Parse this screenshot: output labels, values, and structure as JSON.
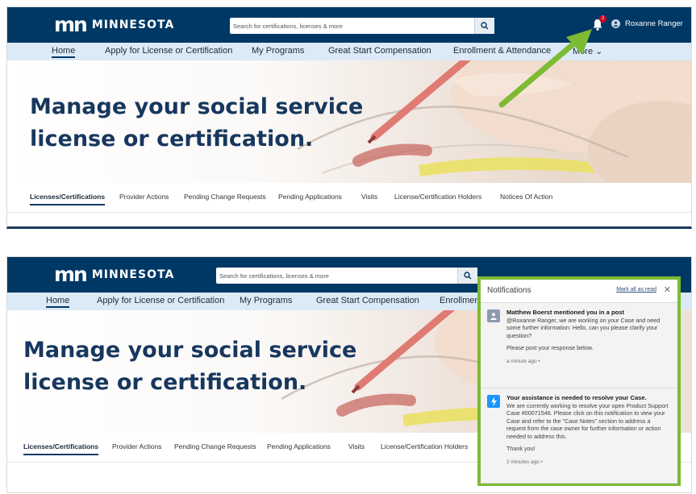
{
  "brand": {
    "mark": "mn",
    "name": "MINNESOTA"
  },
  "search": {
    "placeholder": "Search for certifications, licenses & more"
  },
  "user": {
    "name": "Roxanne Ranger"
  },
  "notifications_badge": "2",
  "nav": [
    "Home",
    "Apply for License or Certification",
    "My Programs",
    "Great Start Compensation",
    "Enrollment & Attendance",
    "More ⌄"
  ],
  "nav2_partial": "Enrollment &",
  "hero": {
    "line1": "Manage your social service",
    "line2": "license or certification."
  },
  "tabs": [
    "Licenses/Certifications",
    "Provider Actions",
    "Pending Change Requests",
    "Pending Applications",
    "Visits",
    "License/Certification Holders",
    "Notices Of Action"
  ],
  "notifications": {
    "title": "Notifications",
    "mark_all": "Mark all as read",
    "items": [
      {
        "heading": "Matthew Boerst mentioned you in a post",
        "body": "@Roxanne Ranger, we are working on your Case and need some further information: Hello, can you please clarify your question?",
        "body2": "Please post your response below.",
        "time": "a minute ago •"
      },
      {
        "heading": "Your assistance is needed to resolve your Case.",
        "body": "We are currently working to resolve your open Product Support Case #00071546. Please click on this notification to view your Case and refer to the \"Case Notes\" section to address a request from the case owner for further information or action needed to address this.",
        "body2": "Thank you!",
        "time": "2 minutes ago •"
      }
    ]
  },
  "colors": {
    "header": "#003865",
    "nav": "#dceaf7",
    "hero_text": "#17375e",
    "highlight": "#7cbb33",
    "badge": "#d0021b"
  }
}
